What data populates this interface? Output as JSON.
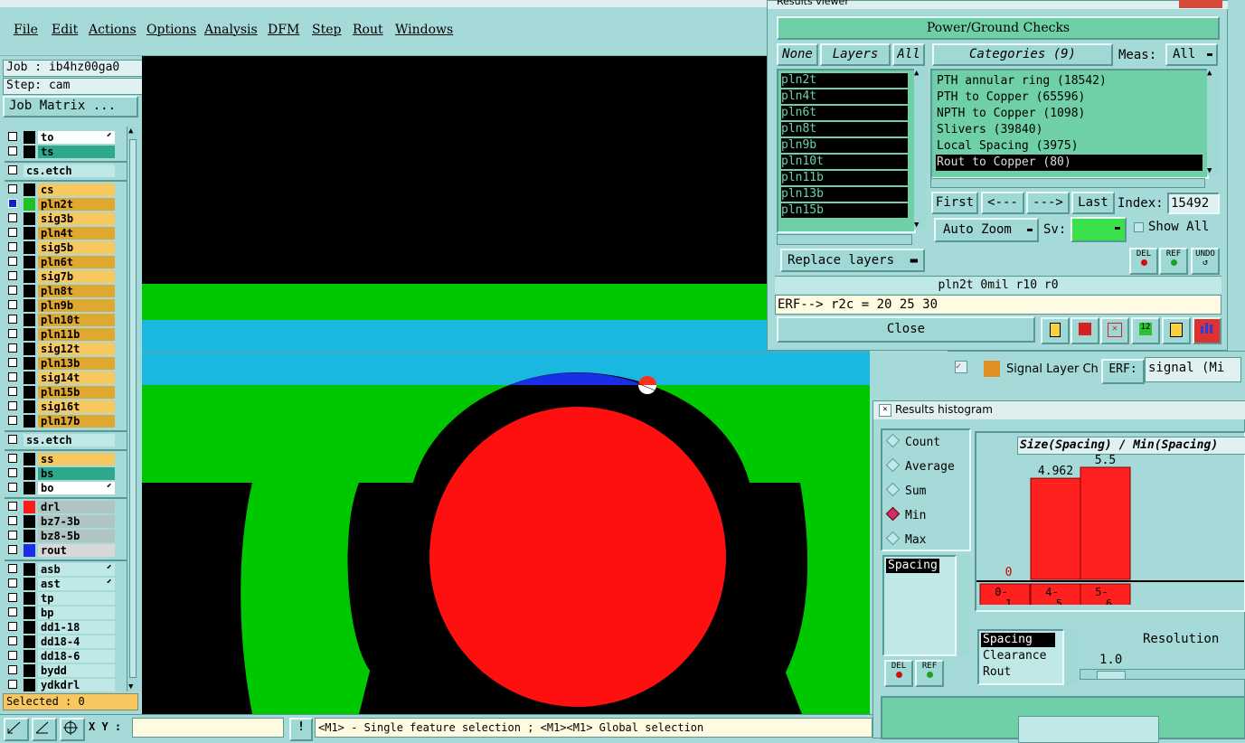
{
  "menubar": {
    "items": [
      "File",
      "Edit",
      "Actions",
      "Options",
      "Analysis",
      "DFM",
      "Step",
      "Rout",
      "Windows"
    ]
  },
  "left_panel": {
    "job": "Job : ib4hz00ga0",
    "step": "Step: cam",
    "job_matrix_label": "Job Matrix ...",
    "selected": "Selected : 0",
    "layers": [
      {
        "name": "to",
        "color": "#ffffff",
        "checked": false,
        "dot": "#000000",
        "arrow": true
      },
      {
        "name": "ts",
        "color": "#2ea88c",
        "checked": false,
        "dot": "#000000",
        "arrow": false
      },
      {
        "name": "cs.etch",
        "color": "#bfe8e6",
        "checked": false,
        "dot": "",
        "arrow": false
      },
      {
        "name": "cs",
        "color": "#f8c860",
        "checked": false,
        "dot": "#000000",
        "arrow": false
      },
      {
        "name": "pln2t",
        "color": "#e0a830",
        "checked": true,
        "dot": "#22c022",
        "arrow": false
      },
      {
        "name": "sig3b",
        "color": "#f8c860",
        "checked": false,
        "dot": "#000000",
        "arrow": false
      },
      {
        "name": "pln4t",
        "color": "#e0a830",
        "checked": false,
        "dot": "#000000",
        "arrow": false
      },
      {
        "name": "sig5b",
        "color": "#f8c860",
        "checked": false,
        "dot": "#000000",
        "arrow": false
      },
      {
        "name": "pln6t",
        "color": "#e0a830",
        "checked": false,
        "dot": "#000000",
        "arrow": false
      },
      {
        "name": "sig7b",
        "color": "#f8c860",
        "checked": false,
        "dot": "#000000",
        "arrow": false
      },
      {
        "name": "pln8t",
        "color": "#e0a830",
        "checked": false,
        "dot": "#000000",
        "arrow": false
      },
      {
        "name": "pln9b",
        "color": "#e0a830",
        "checked": false,
        "dot": "#000000",
        "arrow": false
      },
      {
        "name": "pln10t",
        "color": "#e0a830",
        "checked": false,
        "dot": "#000000",
        "arrow": false
      },
      {
        "name": "pln11b",
        "color": "#e0a830",
        "checked": false,
        "dot": "#000000",
        "arrow": false
      },
      {
        "name": "sig12t",
        "color": "#f8c860",
        "checked": false,
        "dot": "#000000",
        "arrow": false
      },
      {
        "name": "pln13b",
        "color": "#e0a830",
        "checked": false,
        "dot": "#000000",
        "arrow": false
      },
      {
        "name": "sig14t",
        "color": "#f8c860",
        "checked": false,
        "dot": "#000000",
        "arrow": false
      },
      {
        "name": "pln15b",
        "color": "#e0a830",
        "checked": false,
        "dot": "#000000",
        "arrow": false
      },
      {
        "name": "sig16t",
        "color": "#f8c860",
        "checked": false,
        "dot": "#000000",
        "arrow": false
      },
      {
        "name": "pln17b",
        "color": "#e0a830",
        "checked": false,
        "dot": "#000000",
        "arrow": false
      },
      {
        "name": "ss.etch",
        "color": "#bfe8e6",
        "checked": false,
        "dot": "",
        "arrow": false
      },
      {
        "name": "ss",
        "color": "#f8c860",
        "checked": false,
        "dot": "#000000",
        "arrow": false
      },
      {
        "name": "bs",
        "color": "#2ea88c",
        "checked": false,
        "dot": "#000000",
        "arrow": false
      },
      {
        "name": "bo",
        "color": "#ffffff",
        "checked": false,
        "dot": "#000000",
        "arrow": true
      },
      {
        "name": "drl",
        "color": "#b0c4c4",
        "checked": false,
        "dot": "#ff1a1a",
        "arrow": false
      },
      {
        "name": "bz7-3b",
        "color": "#b0c4c4",
        "checked": false,
        "dot": "#000000",
        "arrow": false
      },
      {
        "name": "bz8-5b",
        "color": "#b0c4c4",
        "checked": false,
        "dot": "#000000",
        "arrow": false
      },
      {
        "name": "rout",
        "color": "#d8d8d8",
        "checked": false,
        "dot": "#1a2ee8",
        "arrow": false
      },
      {
        "name": "asb",
        "color": "#bfe8e6",
        "checked": false,
        "dot": "#000000",
        "arrow": true
      },
      {
        "name": "ast",
        "color": "#bfe8e6",
        "checked": false,
        "dot": "#000000",
        "arrow": true
      },
      {
        "name": "tp",
        "color": "#bfe8e6",
        "checked": false,
        "dot": "#000000",
        "arrow": false
      },
      {
        "name": "bp",
        "color": "#bfe8e6",
        "checked": false,
        "dot": "#000000",
        "arrow": false
      },
      {
        "name": "dd1-18",
        "color": "#bfe8e6",
        "checked": false,
        "dot": "#000000",
        "arrow": false
      },
      {
        "name": "dd18-4",
        "color": "#bfe8e6",
        "checked": false,
        "dot": "#000000",
        "arrow": false
      },
      {
        "name": "dd18-6",
        "color": "#bfe8e6",
        "checked": false,
        "dot": "#000000",
        "arrow": false
      },
      {
        "name": "bydd",
        "color": "#bfe8e6",
        "checked": false,
        "dot": "#000000",
        "arrow": false
      },
      {
        "name": "ydkdrl",
        "color": "#bfe8e6",
        "checked": false,
        "dot": "#000000",
        "arrow": false
      }
    ]
  },
  "bottom_bar": {
    "xy_label": "X Y :",
    "xy_value": "",
    "hint": "<M1> - Single feature selection ; <M1><M1> Global selection"
  },
  "results_viewer": {
    "title": "Results viewer",
    "header": "Power/Ground Checks",
    "none_label": "None",
    "layers_label": "Layers",
    "all_label": "All",
    "categories_label": "Categories (9)",
    "meas_label": "Meas:",
    "meas_value": "All",
    "layers": [
      "pln2t",
      "pln4t",
      "pln6t",
      "pln8t",
      "pln9b",
      "pln10t",
      "pln11b",
      "pln13b",
      "pln15b"
    ],
    "categories": [
      "PTH annular ring (18542)",
      "PTH to Copper (65596)",
      "NPTH to Copper (1098)",
      "Slivers (39840)",
      "Local Spacing (3975)",
      "Rout to Copper (80)"
    ],
    "selected_category": 5,
    "first_label": "First",
    "prev_label": "<---",
    "next_label": "--->",
    "last_label": "Last",
    "index_label": "Index:",
    "index_value": "15492",
    "auto_zoom_label": "Auto Zoom",
    "sv_label": "Sv:",
    "show_all_label": "Show All",
    "replace_layers_label": "Replace layers",
    "del_label": "DEL",
    "ref_label": "REF",
    "undo_label": "UNDO",
    "status_line": "pln2t  0mil   r10   r0",
    "erf_line": "ERF--> r2c = 20 25 30",
    "close_label": "Close"
  },
  "signal_strip": {
    "title": "Signal Layer Ch",
    "erf_label": "ERF:",
    "erf_value": "signal (Mi"
  },
  "histogram": {
    "title": "Results histogram",
    "options": [
      "Count",
      "Average",
      "Sum",
      "Min",
      "Max"
    ],
    "selected_option": "Min",
    "list1": [
      "Spacing"
    ],
    "list2": [
      "Spacing",
      "Clearance",
      "Rout"
    ],
    "resolution_label": "Resolution",
    "resolution_value": "1.0",
    "del_label": "DEL",
    "ref_label": "REF",
    "chart_data": {
      "type": "bar",
      "title": "Size(Spacing) / Min(Spacing)",
      "categories": [
        "0-1",
        "4-5",
        "5-6"
      ],
      "values": [
        0,
        4.962,
        5.5
      ],
      "data_labels": [
        "0",
        "4.962",
        "5.5"
      ],
      "bar_color": "#ff2020"
    }
  }
}
